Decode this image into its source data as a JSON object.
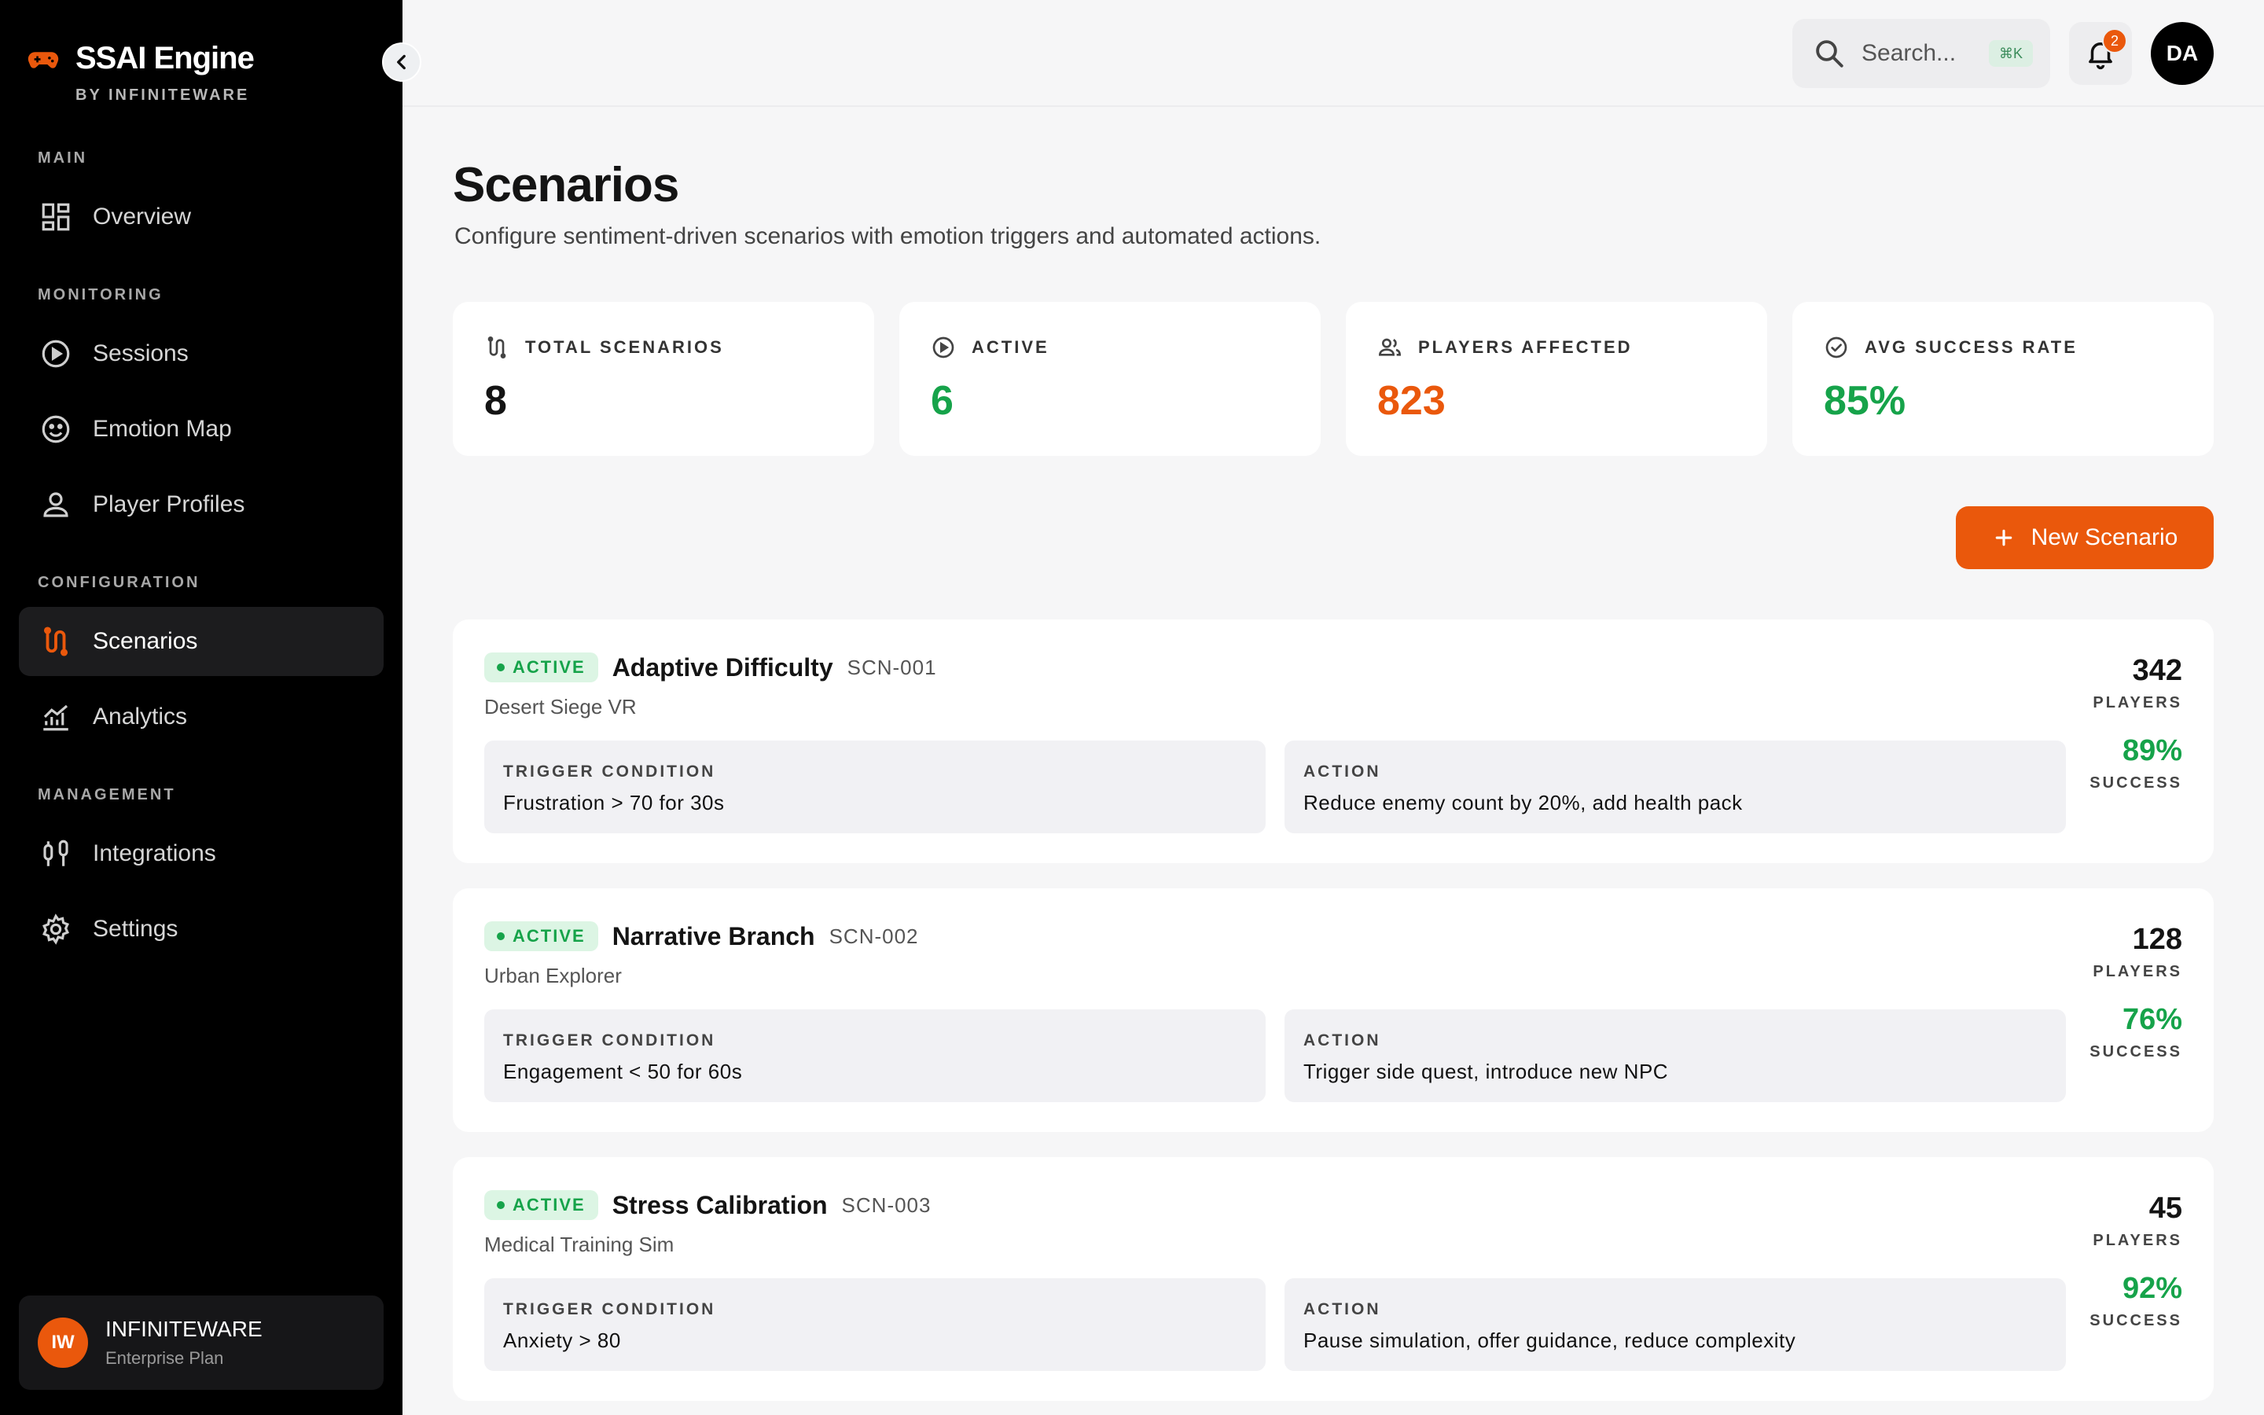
{
  "brand": {
    "name": "SSAI Engine",
    "subtitle": "BY INFINITEWARE"
  },
  "sidebar": {
    "sections": [
      {
        "label": "MAIN"
      },
      {
        "label": "MONITORING"
      },
      {
        "label": "CONFIGURATION"
      },
      {
        "label": "MANAGEMENT"
      }
    ],
    "items": [
      {
        "label": "Overview",
        "icon": "dashboard-icon"
      },
      {
        "label": "Sessions",
        "icon": "play-circle-icon"
      },
      {
        "label": "Emotion Map",
        "icon": "smiley-icon"
      },
      {
        "label": "Player Profiles",
        "icon": "person-icon"
      },
      {
        "label": "Scenarios",
        "icon": "route-icon",
        "active": true
      },
      {
        "label": "Analytics",
        "icon": "chart-icon"
      },
      {
        "label": "Integrations",
        "icon": "plug-icon"
      },
      {
        "label": "Settings",
        "icon": "gear-icon"
      }
    ],
    "org": {
      "initials": "IW",
      "name": "INFINITEWARE",
      "plan": "Enterprise Plan"
    }
  },
  "header": {
    "search_placeholder": "Search...",
    "search_shortcut": "⌘K",
    "notification_count": "2",
    "user_initials": "DA"
  },
  "page": {
    "title": "Scenarios",
    "subtitle": "Configure sentiment-driven scenarios with emotion triggers and automated actions."
  },
  "stats": [
    {
      "label": "TOTAL SCENARIOS",
      "value": "8",
      "color": "#141414"
    },
    {
      "label": "ACTIVE",
      "value": "6",
      "color": "#16a34a"
    },
    {
      "label": "PLAYERS AFFECTED",
      "value": "823",
      "color": "#ea580c"
    },
    {
      "label": "AVG SUCCESS RATE",
      "value": "85%",
      "color": "#16a34a"
    }
  ],
  "new_scenario_label": "New Scenario",
  "labels": {
    "trigger": "TRIGGER CONDITION",
    "action": "ACTION",
    "players": "PLAYERS",
    "success": "SUCCESS"
  },
  "scenarios": [
    {
      "status": "ACTIVE",
      "name": "Adaptive Difficulty",
      "id": "SCN-001",
      "game": "Desert Siege VR",
      "trigger": "Frustration > 70 for 30s",
      "action": "Reduce enemy count by 20%, add health pack",
      "players": "342",
      "success": "89%"
    },
    {
      "status": "ACTIVE",
      "name": "Narrative Branch",
      "id": "SCN-002",
      "game": "Urban Explorer",
      "trigger": "Engagement < 50 for 60s",
      "action": "Trigger side quest, introduce new NPC",
      "players": "128",
      "success": "76%"
    },
    {
      "status": "ACTIVE",
      "name": "Stress Calibration",
      "id": "SCN-003",
      "game": "Medical Training Sim",
      "trigger": "Anxiety > 80",
      "action": "Pause simulation, offer guidance, reduce complexity",
      "players": "45",
      "success": "92%"
    }
  ],
  "colors": {
    "accent": "#ea580c",
    "success": "#16a34a",
    "sidebar_bg": "#000000"
  }
}
